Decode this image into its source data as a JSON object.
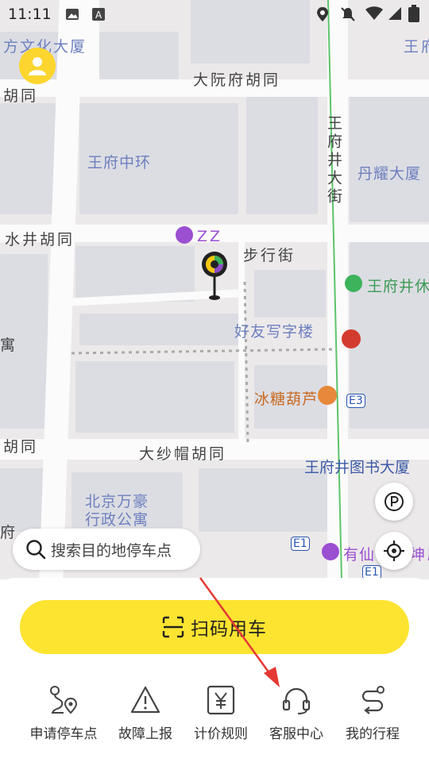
{
  "status_bar": {
    "time": "11:11"
  },
  "map": {
    "labels": {
      "fang_wenhua": "方文化大厦",
      "wangfu_top": "王府",
      "dayuan": "大阮府胡同",
      "hutong_left": "胡同",
      "wangfu_zhonghuan": "王府中环",
      "wangfujing_st": "王府井大街",
      "danyao": "丹耀大厦",
      "shuijing": "水井胡同",
      "zz": "ZZ",
      "buxingjie": "步行街",
      "wangfujing_xiu": "王府井休",
      "haoyou": "好友写字楼",
      "yu": "寓",
      "binghulu": "冰糖葫芦",
      "e3": "E3",
      "hutong_left2": "胡同",
      "dashamao": "大纱帽胡同",
      "library": "王府井图书大厦",
      "beijing_wanhao_1": "北京万豪",
      "beijing_wanhao_2": "行政公寓",
      "fu": "府",
      "e1_left": "E1",
      "youxian": "有仙",
      "shenxiang": "坤殿",
      "e1_bottom": "E1"
    }
  },
  "search": {
    "placeholder": "搜索目的地停车点"
  },
  "scan_button": {
    "label": "扫码用车"
  },
  "actions": [
    {
      "label": "申请停车点",
      "icon": "route-location-icon"
    },
    {
      "label": "故障上报",
      "icon": "warning-icon"
    },
    {
      "label": "计价规则",
      "icon": "yuan-price-icon"
    },
    {
      "label": "客服中心",
      "icon": "headset-icon"
    },
    {
      "label": "我的行程",
      "icon": "trip-route-icon"
    }
  ],
  "colors": {
    "accent": "#fde430",
    "annotation_arrow": "#e53935"
  }
}
